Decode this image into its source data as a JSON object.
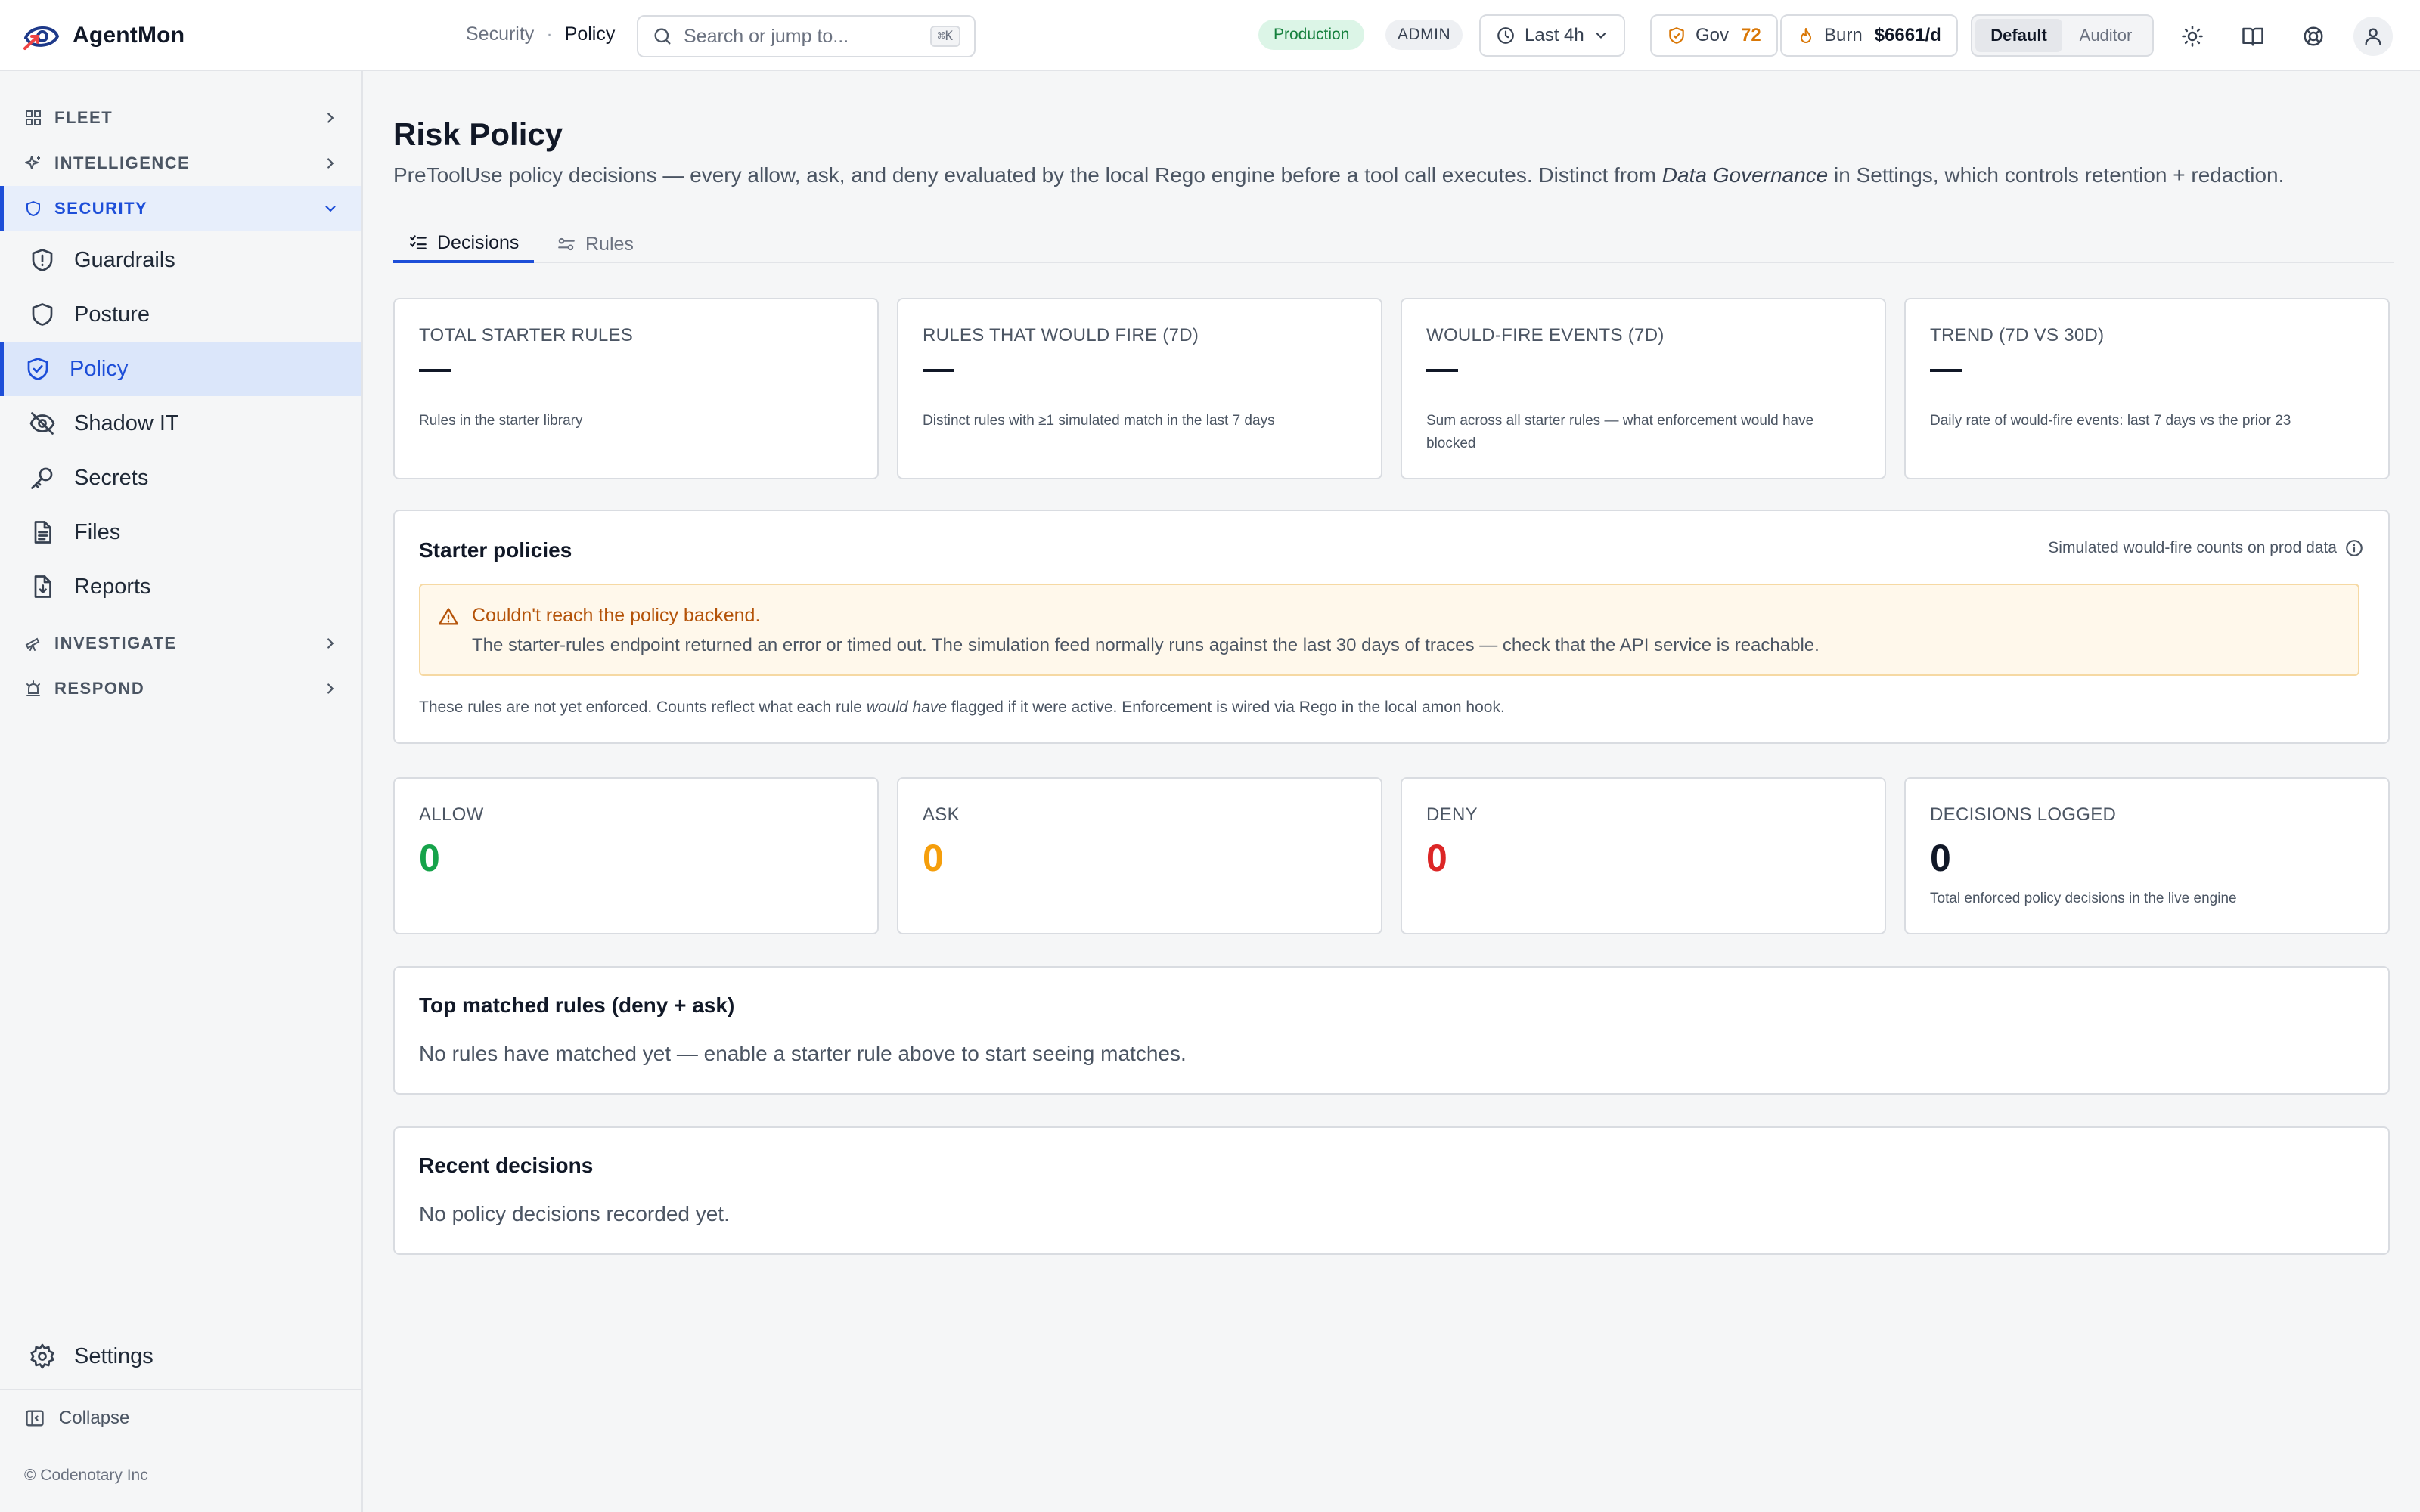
{
  "app": {
    "name": "AgentMon"
  },
  "header": {
    "breadcrumb": {
      "parent": "Security",
      "separator": "·",
      "current": "Policy"
    },
    "search": {
      "placeholder": "Search or jump to...",
      "shortcut": "⌘K"
    },
    "environment": "Production",
    "role": "ADMIN",
    "time_range": "Last 4h",
    "gov": {
      "label": "Gov",
      "value": "72"
    },
    "burn": {
      "label": "Burn",
      "value": "$6661/d"
    },
    "view_modes": [
      "Default",
      "Auditor"
    ],
    "active_view_mode": "Default",
    "icons": [
      "sun-icon",
      "book-icon",
      "lifebuoy-icon",
      "user-icon"
    ]
  },
  "sidebar": {
    "sections": [
      {
        "label": "FLEET",
        "expanded": false
      },
      {
        "label": "INTELLIGENCE",
        "expanded": false
      },
      {
        "label": "SECURITY",
        "expanded": true
      },
      {
        "label": "INVESTIGATE",
        "expanded": false
      },
      {
        "label": "RESPOND",
        "expanded": false
      }
    ],
    "security_items": [
      {
        "label": "Guardrails",
        "icon": "shield-alert-icon"
      },
      {
        "label": "Posture",
        "icon": "shield-icon"
      },
      {
        "label": "Policy",
        "icon": "shield-check-icon",
        "active": true
      },
      {
        "label": "Shadow IT",
        "icon": "eye-off-icon"
      },
      {
        "label": "Secrets",
        "icon": "key-icon"
      },
      {
        "label": "Files",
        "icon": "file-text-icon"
      },
      {
        "label": "Reports",
        "icon": "file-download-icon"
      }
    ],
    "settings": "Settings",
    "collapse": "Collapse",
    "copyright": "© Codenotary Inc"
  },
  "page": {
    "title": "Risk Policy",
    "description_before": "PreToolUse policy decisions — every allow, ask, and deny evaluated by the local Rego engine before a tool call executes. Distinct from ",
    "description_emphasis": "Data Governance",
    "description_after": " in Settings, which controls retention + redaction.",
    "tabs": [
      {
        "label": "Decisions",
        "active": true
      },
      {
        "label": "Rules",
        "active": false
      }
    ]
  },
  "kpis": [
    {
      "label": "TOTAL STARTER RULES",
      "value": "—",
      "sub": "Rules in the starter library"
    },
    {
      "label": "RULES THAT WOULD FIRE (7D)",
      "value": "—",
      "sub": "Distinct rules with ≥1 simulated match in the last 7 days"
    },
    {
      "label": "WOULD-FIRE EVENTS (7D)",
      "value": "—",
      "sub": "Sum across all starter rules — what enforcement would have blocked"
    },
    {
      "label": "TREND (7D VS 30D)",
      "value": "—",
      "sub": "Daily rate of would-fire events: last 7 days vs the prior 23"
    }
  ],
  "starter_policies": {
    "title": "Starter policies",
    "right_note": "Simulated would-fire counts on prod data",
    "alert": {
      "title": "Couldn't reach the policy backend.",
      "body": "The starter-rules endpoint returned an error or timed out. The simulation feed normally runs against the last 30 days of traces — check that the API service is reachable."
    },
    "note_before": "These rules are not yet enforced. Counts reflect what each rule ",
    "note_emphasis": "would have",
    "note_after": " flagged if it were active. Enforcement is wired via Rego in the local amon hook."
  },
  "decisions": [
    {
      "label": "ALLOW",
      "value": "0",
      "color": "#16a34a",
      "sub": ""
    },
    {
      "label": "ASK",
      "value": "0",
      "color": "#f59e0b",
      "sub": ""
    },
    {
      "label": "DENY",
      "value": "0",
      "color": "#dc2626",
      "sub": ""
    },
    {
      "label": "DECISIONS LOGGED",
      "value": "0",
      "color": "#111827",
      "sub": "Total enforced policy decisions in the live engine"
    }
  ],
  "top_matched": {
    "title": "Top matched rules (deny + ask)",
    "empty": "No rules have matched yet — enable a starter rule above to start seeing matches."
  },
  "recent": {
    "title": "Recent decisions",
    "empty": "No policy decisions recorded yet."
  },
  "colors": {
    "accent": "#1d4ed8",
    "warning": "#b45309",
    "allow": "#16a34a",
    "ask": "#f59e0b",
    "deny": "#dc2626"
  }
}
